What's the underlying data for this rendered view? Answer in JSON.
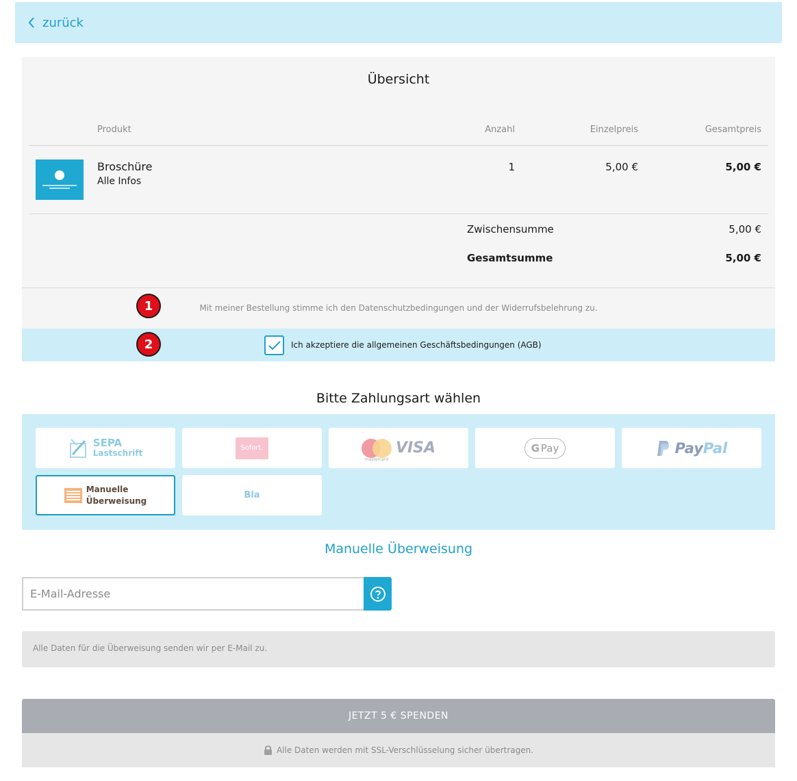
{
  "nav": {
    "back_label": "zurück"
  },
  "overview": {
    "title": "Übersicht",
    "columns": {
      "product": "Produkt",
      "quantity": "Anzahl",
      "unit_price": "Einzelpreis",
      "total_price": "Gesamtpreis"
    },
    "item": {
      "name": "Broschüre",
      "subtitle": "Alle Infos",
      "quantity": "1",
      "unit_price": "5,00 €",
      "total_price": "5,00 €"
    },
    "subtotal_label": "Zwischensumme",
    "subtotal_value": "5,00 €",
    "total_label": "Gesamtsumme",
    "total_value": "5,00 €"
  },
  "consent": {
    "privacy_text": "Mit meiner Bestellung stimme ich den Datenschutzbedingungen und der Widerrufsbelehrung zu.",
    "agb_label": "Ich akzeptiere die allgemeinen Geschäftsbedingungen (AGB)",
    "agb_checked": true
  },
  "annotations": {
    "badge_1": "1",
    "badge_2": "2",
    "badge_color": "#e0101a"
  },
  "payment": {
    "title": "Bitte Zahlungsart wählen",
    "methods": [
      {
        "id": "sepa",
        "label_main": "SEPA",
        "label_sub": "Lastschrift",
        "icon": "sepa-icon"
      },
      {
        "id": "sofort",
        "label": "Sofort.",
        "icon": "sofort-logo"
      },
      {
        "id": "card",
        "label": "VISA",
        "mc_label": "mastercard",
        "icon": "mastercard-visa-logo"
      },
      {
        "id": "gpay",
        "label_g": "G",
        "label_pay": "Pay",
        "icon": "google-pay-logo"
      },
      {
        "id": "paypal",
        "label_pay": "Pay",
        "label_pal": "Pal",
        "icon": "paypal-logo"
      },
      {
        "id": "manual",
        "label_line1": "Manuelle",
        "label_line2": "Überweisung",
        "icon": "bank-transfer-icon",
        "selected": true
      },
      {
        "id": "bla",
        "label": "Bla"
      }
    ],
    "selected_title": "Manuelle Überweisung"
  },
  "form": {
    "email_placeholder": "E-Mail-Adresse",
    "email_value": "",
    "info_text": "Alle Daten für die Überweisung senden wir per E-Mail zu."
  },
  "submit": {
    "donate_label": "JETZT 5 € SPENDEN",
    "ssl_text": "Alle Daten werden mit SSL-Verschlüsselung sicher übertragen."
  },
  "colors": {
    "accent": "#22a0cc",
    "light_blue_bg": "#cdeef8",
    "panel_bg": "#f5f5f5",
    "button_disabled": "#a9acb2"
  }
}
